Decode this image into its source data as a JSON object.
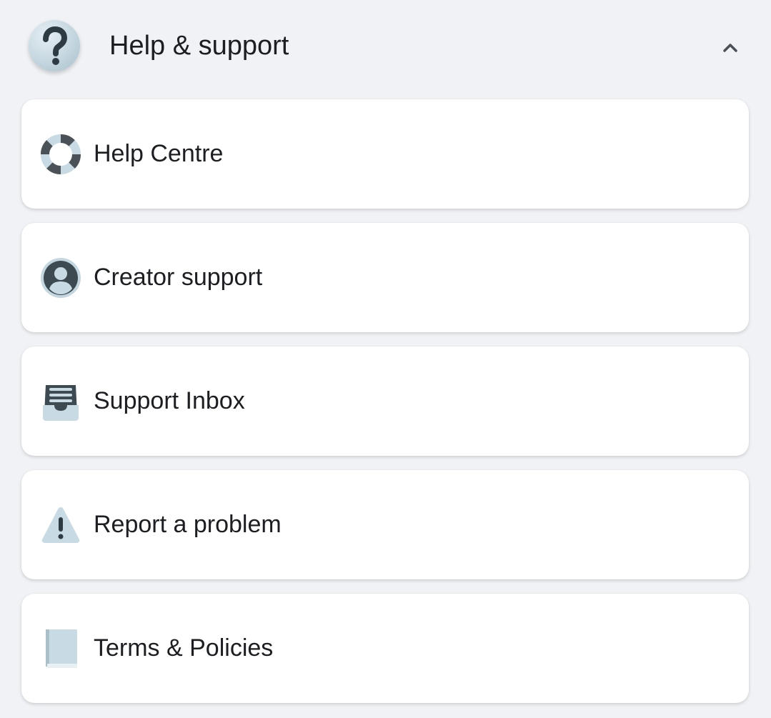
{
  "section": {
    "title": "Help & support",
    "icon": "question-mark-icon",
    "collapse_icon": "chevron-up-icon"
  },
  "items": [
    {
      "label": "Help Centre",
      "icon": "lifebuoy-icon"
    },
    {
      "label": "Creator support",
      "icon": "person-circle-icon"
    },
    {
      "label": "Support Inbox",
      "icon": "inbox-tray-icon"
    },
    {
      "label": "Report a problem",
      "icon": "warning-triangle-icon"
    },
    {
      "label": "Terms & Policies",
      "icon": "book-icon"
    }
  ],
  "colors": {
    "background": "#f0f2f5",
    "card": "#ffffff",
    "text": "#1c1e21",
    "icon_dark": "#3a4750",
    "icon_light": "#c8dae3"
  }
}
